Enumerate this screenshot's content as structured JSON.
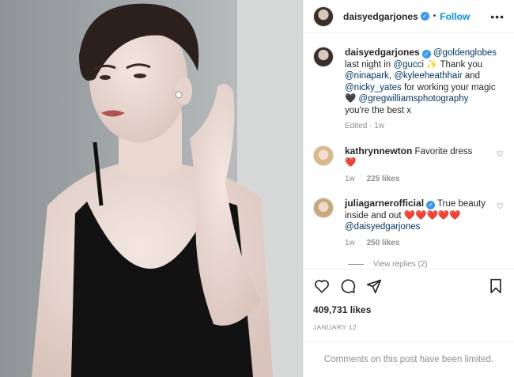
{
  "post": {
    "author": "daisyedgarjones",
    "follow_label": "Follow",
    "dot": "•",
    "more": "•••",
    "verified_mark": "✓"
  },
  "caption": {
    "author": "daisyedgarjones",
    "mention_1": "@goldenglobes",
    "text_1": "last night in",
    "mention_2": "@gucci",
    "sparkle": "✨",
    "text_2": "Thank you",
    "mention_3": "@ninapark",
    "comma_1": ",",
    "mention_4": "@kyleeheathhair",
    "text_3": "and",
    "mention_5": "@nicky_yates",
    "text_4": "for working your magic",
    "black_heart": "🖤",
    "mention_6": "@gregwilliamsphotography",
    "text_5": "you're the best x",
    "edited": "Edited",
    "time": "1w"
  },
  "comments": [
    {
      "author": "kathrynnewton",
      "text": "Favorite dress",
      "emoji": "❤️",
      "time": "1w",
      "likes": "225 likes"
    },
    {
      "author": "juliagarnerofficial",
      "text_1": "True beauty",
      "text_2": "inside and out",
      "emoji": "❤️❤️❤️❤️❤️",
      "mention": "@daisyedgarjones",
      "time": "1w",
      "likes": "250 likes"
    }
  ],
  "view_replies": "View replies (2)",
  "likes_count": "409,731 likes",
  "post_date": "JANUARY 12",
  "comments_limited": "Comments on this post have been limited.",
  "colors": {
    "accent": "#0095f6",
    "link": "#00376b",
    "verified": "#3897f0",
    "muted": "#8e8e8e"
  },
  "icons": [
    "heart-icon",
    "comment-icon",
    "share-icon",
    "bookmark-icon",
    "more-icon",
    "verified-icon"
  ]
}
